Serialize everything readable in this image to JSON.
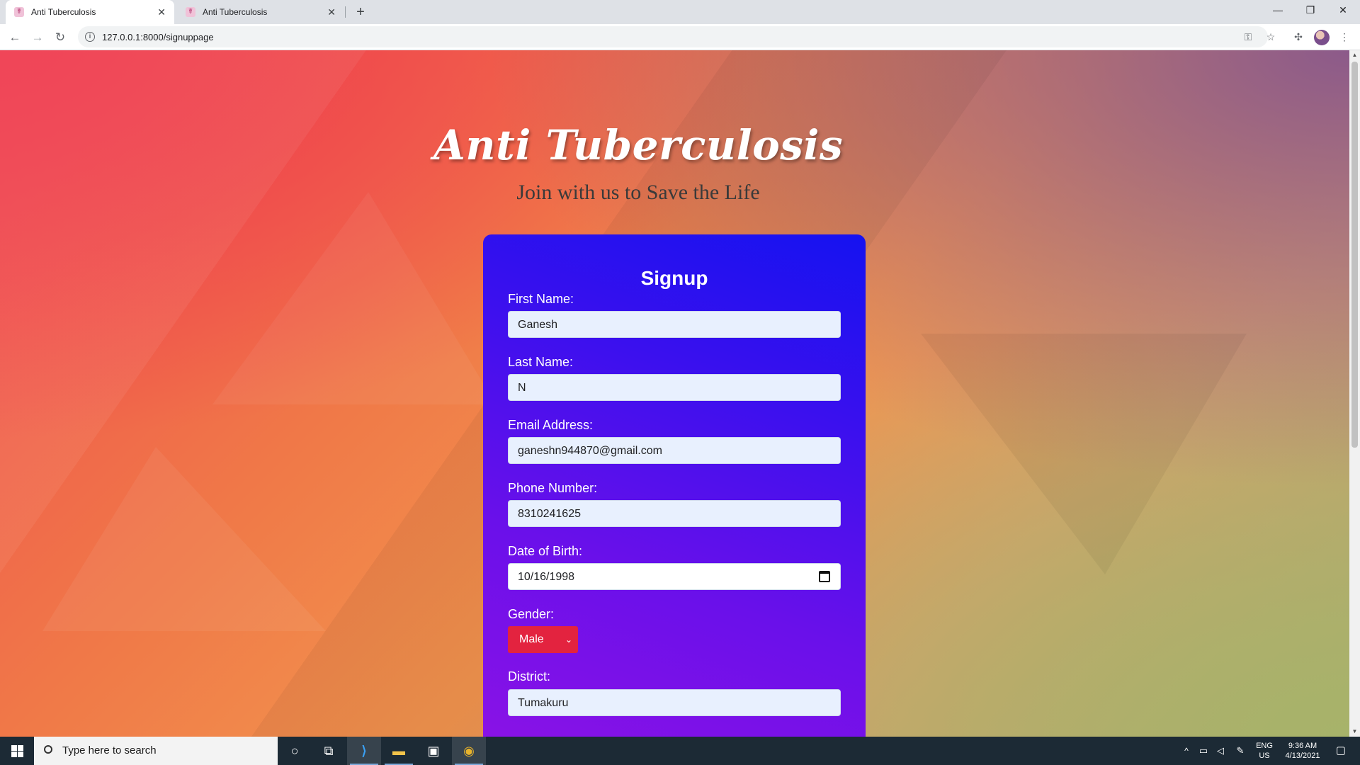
{
  "browser": {
    "tabs": [
      {
        "title": "Anti Tuberculosis",
        "active": true
      },
      {
        "title": "Anti Tuberculosis",
        "active": false
      }
    ],
    "url": "127.0.0.1:8000/signuppage"
  },
  "page": {
    "title": "Anti Tuberculosis",
    "subtitle": "Join with us to Save the Life",
    "form": {
      "heading": "Signup",
      "first_name_label": "First Name:",
      "first_name_value": "Ganesh",
      "last_name_label": "Last Name:",
      "last_name_value": "N",
      "email_label": "Email Address:",
      "email_value": "ganeshn944870@gmail.com",
      "phone_label": "Phone Number:",
      "phone_value": "8310241625",
      "dob_label": "Date of Birth:",
      "dob_value": "10/16/1998",
      "gender_label": "Gender:",
      "gender_value": "Male",
      "district_label": "District:",
      "district_value": "Tumakuru"
    },
    "colors": {
      "card_top": "#1512f0",
      "card_bottom": "#8a12e6",
      "select_bg": "#e3233f",
      "input_bg": "#e8f0fe"
    }
  },
  "taskbar": {
    "search_placeholder": "Type here to search",
    "lang_top": "ENG",
    "lang_bottom": "US",
    "time": "9:36 AM",
    "date": "4/13/2021"
  }
}
